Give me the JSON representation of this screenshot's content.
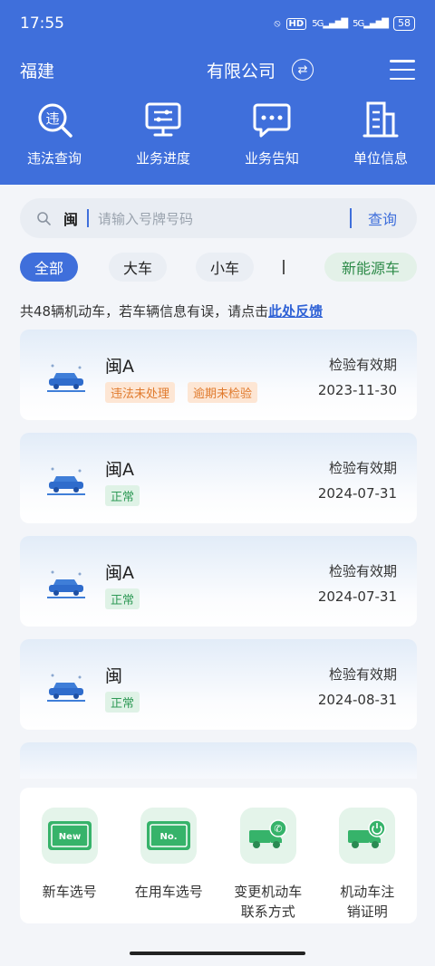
{
  "status": {
    "time": "17:55",
    "hd": "HD",
    "sig1": "5G",
    "sig2": "5G",
    "battery": "58"
  },
  "header": {
    "org_prefix": "福建",
    "org_suffix": "有限公司"
  },
  "quick_actions": [
    {
      "label": "违法查询",
      "icon": "violation-search-icon"
    },
    {
      "label": "业务进度",
      "icon": "monitor-progress-icon"
    },
    {
      "label": "业务告知",
      "icon": "message-icon"
    },
    {
      "label": "单位信息",
      "icon": "building-icon"
    }
  ],
  "search": {
    "province": "闽",
    "placeholder": "请输入号牌号码",
    "button": "查询"
  },
  "filters": {
    "all": "全部",
    "large": "大车",
    "small": "小车",
    "new_energy": "新能源车"
  },
  "notice": {
    "text": "共48辆机动车，若车辆信息有误，请点击",
    "link": "此处反馈"
  },
  "vehicles": [
    {
      "plate": "闽A",
      "tags": [
        "违法未处理",
        "逾期未检验"
      ],
      "expiry_label": "检验有效期",
      "expiry_date": "2023-11-30"
    },
    {
      "plate": "闽A",
      "tags": [
        "正常"
      ],
      "expiry_label": "检验有效期",
      "expiry_date": "2024-07-31"
    },
    {
      "plate": "闽A",
      "tags": [
        "正常"
      ],
      "expiry_label": "检验有效期",
      "expiry_date": "2024-07-31"
    },
    {
      "plate": "闽",
      "tags": [
        "正常"
      ],
      "expiry_label": "检验有效期",
      "expiry_date": "2024-08-31"
    }
  ],
  "bottom_actions": [
    {
      "line1": "新车选号",
      "line2": "",
      "icon_text": "New"
    },
    {
      "line1": "在用车选号",
      "line2": "",
      "icon_text": "No."
    },
    {
      "line1": "变更机动车",
      "line2": "联系方式",
      "icon_text": ""
    },
    {
      "line1": "机动车注",
      "line2": "销证明",
      "icon_text": ""
    }
  ],
  "colors": {
    "primary": "#3f6fdb",
    "warn_tag": "#e07a2d",
    "ok_tag": "#2f9a57",
    "green_icon": "#36b36a"
  }
}
